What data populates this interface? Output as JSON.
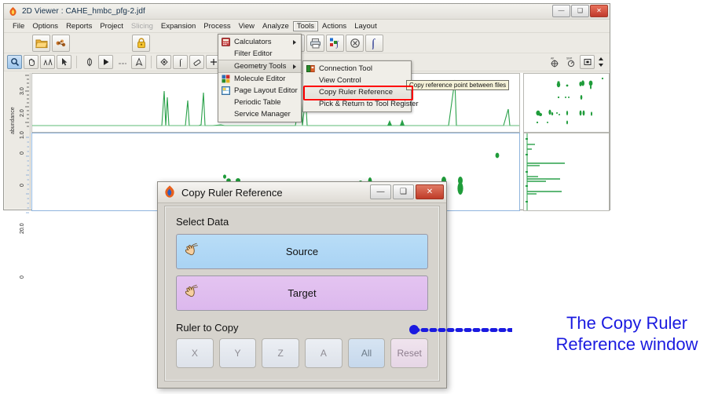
{
  "app": {
    "title": "2D Viewer : CAHE_hmbc_pfg-2.jdf",
    "titlebar_icon": "app-flame-icon",
    "window_buttons": {
      "minimize": "—",
      "maximize": "❑",
      "close": "✕"
    }
  },
  "menubar": {
    "items": [
      {
        "label": "File",
        "state": "normal"
      },
      {
        "label": "Options",
        "state": "normal"
      },
      {
        "label": "Reports",
        "state": "normal"
      },
      {
        "label": "Project",
        "state": "normal"
      },
      {
        "label": "Slicing",
        "state": "disabled"
      },
      {
        "label": "Expansion",
        "state": "normal"
      },
      {
        "label": "Process",
        "state": "normal"
      },
      {
        "label": "View",
        "state": "normal"
      },
      {
        "label": "Analyze",
        "state": "normal"
      },
      {
        "label": "Tools",
        "state": "active"
      },
      {
        "label": "Actions",
        "state": "normal"
      },
      {
        "label": "Layout",
        "state": "normal"
      }
    ]
  },
  "tools_menu": {
    "items": [
      {
        "label": "Calculators",
        "icon": "calculator-icon",
        "submenu": true,
        "highlighted": false
      },
      {
        "label": "Filter Editor",
        "icon": "",
        "submenu": false,
        "highlighted": false
      },
      {
        "label": "Geometry Tools",
        "icon": "",
        "submenu": true,
        "highlighted": true
      },
      {
        "label": "Molecule Editor",
        "icon": "molecule-icon",
        "submenu": false,
        "highlighted": false
      },
      {
        "label": "Page Layout Editor",
        "icon": "page-layout-icon",
        "submenu": false,
        "highlighted": false
      },
      {
        "label": "Periodic Table",
        "icon": "",
        "submenu": false,
        "highlighted": false
      },
      {
        "label": "Service Manager",
        "icon": "",
        "submenu": false,
        "highlighted": false
      }
    ]
  },
  "geometry_submenu": {
    "items": [
      {
        "label": "Connection Tool",
        "icon": "connection-tool-icon",
        "selected": false
      },
      {
        "label": "View Control",
        "icon": "",
        "selected": false
      },
      {
        "label": "Copy Ruler Reference",
        "icon": "",
        "selected": true
      },
      {
        "label": "Pick & Return to Tool Register",
        "icon": "",
        "selected": false
      }
    ]
  },
  "tooltip": {
    "text": "Copy reference point between files"
  },
  "plot": {
    "y_axis_label": "abundance",
    "top_ticks": [
      "3.0",
      "2.0",
      "1.0",
      "0"
    ],
    "bottom_ticks": [
      "0",
      "20.0",
      "0"
    ]
  },
  "dialog": {
    "title": "Copy Ruler Reference",
    "title_icon": "app-flame-icon",
    "window_buttons": {
      "minimize": "—",
      "maximize": "❑",
      "close": "✕"
    },
    "select_data_label": "Select Data",
    "source_button": "Source",
    "target_button": "Target",
    "source_icon": "pointing-hand-icon",
    "target_icon": "pointing-hand-icon",
    "ruler_label": "Ruler to Copy",
    "ruler_buttons": [
      {
        "label": "X",
        "style": "normal"
      },
      {
        "label": "Y",
        "style": "normal"
      },
      {
        "label": "Z",
        "style": "normal"
      },
      {
        "label": "A",
        "style": "normal"
      },
      {
        "label": "All",
        "style": "all"
      },
      {
        "label": "Reset",
        "style": "reset"
      }
    ]
  },
  "callout": {
    "line1": "The Copy Ruler",
    "line2": "Reference window",
    "color": "#1a1ae0"
  },
  "colors": {
    "spectrum_green": "#1f9c3a",
    "highlight_red": "#ff0000",
    "source_blue": "#aed6f5",
    "target_purple": "#ddbdee",
    "callout_blue": "#1a1ae0"
  }
}
